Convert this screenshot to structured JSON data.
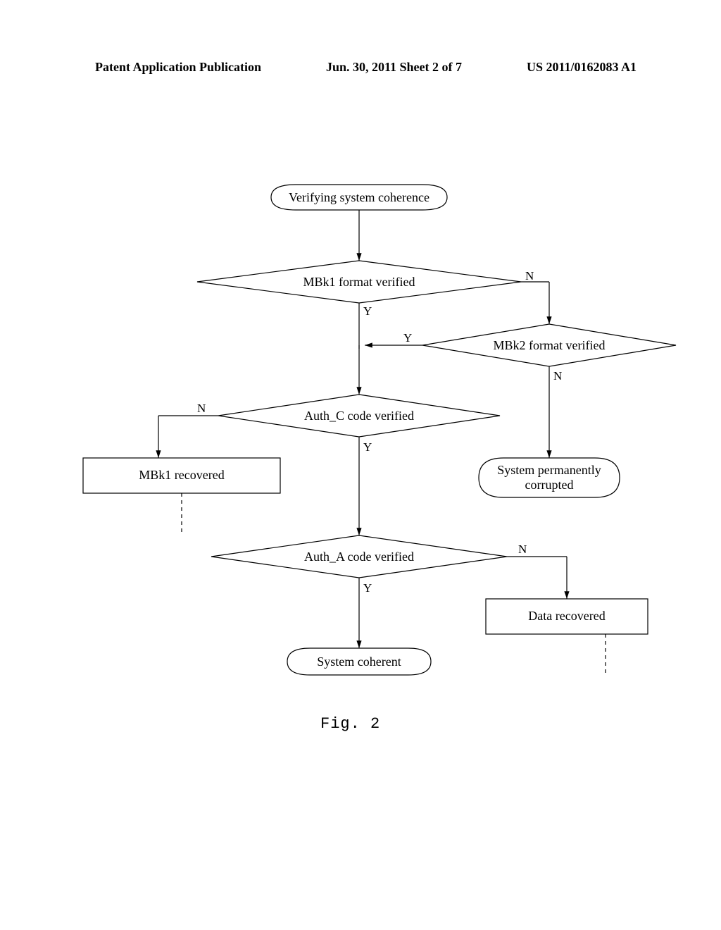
{
  "header": {
    "left": "Patent Application Publication",
    "center": "Jun. 30, 2011  Sheet 2 of 7",
    "right": "US 2011/0162083 A1"
  },
  "chart_data": {
    "type": "flowchart",
    "nodes": [
      {
        "id": "start",
        "shape": "terminator",
        "text": "Verifying system coherence"
      },
      {
        "id": "d1",
        "shape": "decision",
        "text": "MBk1 format verified"
      },
      {
        "id": "d2",
        "shape": "decision",
        "text": "MBk2 format verified"
      },
      {
        "id": "d3",
        "shape": "decision",
        "text": "Auth_C code verified"
      },
      {
        "id": "p1",
        "shape": "process",
        "text": "MBk1 recovered"
      },
      {
        "id": "t1",
        "shape": "terminator",
        "text": "System permanently corrupted"
      },
      {
        "id": "d4",
        "shape": "decision",
        "text": "Auth_A code verified"
      },
      {
        "id": "p2",
        "shape": "process",
        "text": "Data recovered"
      },
      {
        "id": "end",
        "shape": "terminator",
        "text": "System coherent"
      }
    ],
    "edges": [
      {
        "from": "start",
        "to": "d1",
        "label": ""
      },
      {
        "from": "d1",
        "to": "d3",
        "label": "Y"
      },
      {
        "from": "d1",
        "to": "d2",
        "label": "N"
      },
      {
        "from": "d2",
        "to": "d3",
        "label": "Y",
        "note": "joins Y path"
      },
      {
        "from": "d2",
        "to": "t1",
        "label": "N"
      },
      {
        "from": "d3",
        "to": "p1",
        "label": "N"
      },
      {
        "from": "d3",
        "to": "d4",
        "label": "Y"
      },
      {
        "from": "d4",
        "to": "end",
        "label": "Y"
      },
      {
        "from": "d4",
        "to": "p2",
        "label": "N"
      },
      {
        "from": "p1",
        "to": "continuation",
        "label": "",
        "style": "dashed"
      },
      {
        "from": "p2",
        "to": "continuation",
        "label": "",
        "style": "dashed"
      }
    ]
  },
  "labels": {
    "start": "Verifying system coherence",
    "d1": "MBk1 format verified",
    "d2": "MBk2 format verified",
    "d3": "Auth_C code verified",
    "p1": "MBk1 recovered",
    "t1_l1": "System permanently",
    "t1_l2": "corrupted",
    "d4": "Auth_A code verified",
    "p2": "Data recovered",
    "end": "System coherent",
    "Y": "Y",
    "N": "N",
    "fig": "Fig.  2"
  }
}
